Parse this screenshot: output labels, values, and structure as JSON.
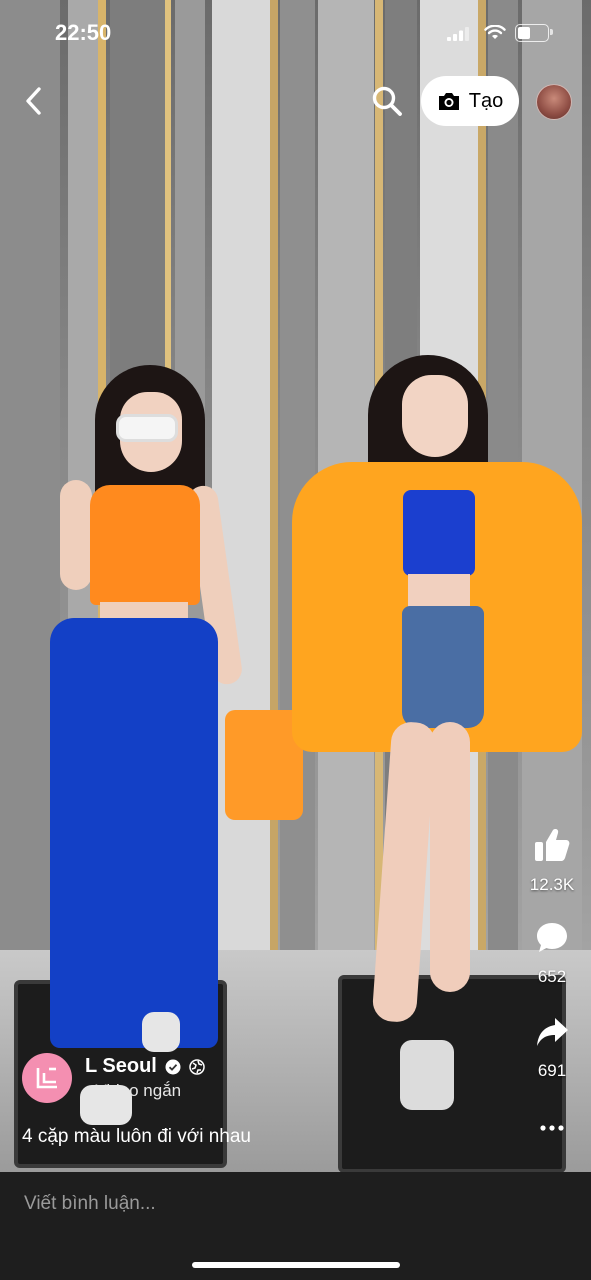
{
  "status_bar": {
    "time": "22:50",
    "battery_level": 0.45
  },
  "topbar": {
    "create_label": "Tạo"
  },
  "actions": {
    "likes": "12.3K",
    "comments": "652",
    "shares": "691"
  },
  "post": {
    "page_name": "L Seoul",
    "post_type": "· Video ngắn",
    "caption": "4 cặp màu luôn đi với nhau"
  },
  "comment": {
    "placeholder": "Viết bình luận..."
  },
  "colors": {
    "accent_orange": "#ff8a1e",
    "accent_blue": "#1340c6",
    "avatar_pink": "#f48fb1"
  }
}
